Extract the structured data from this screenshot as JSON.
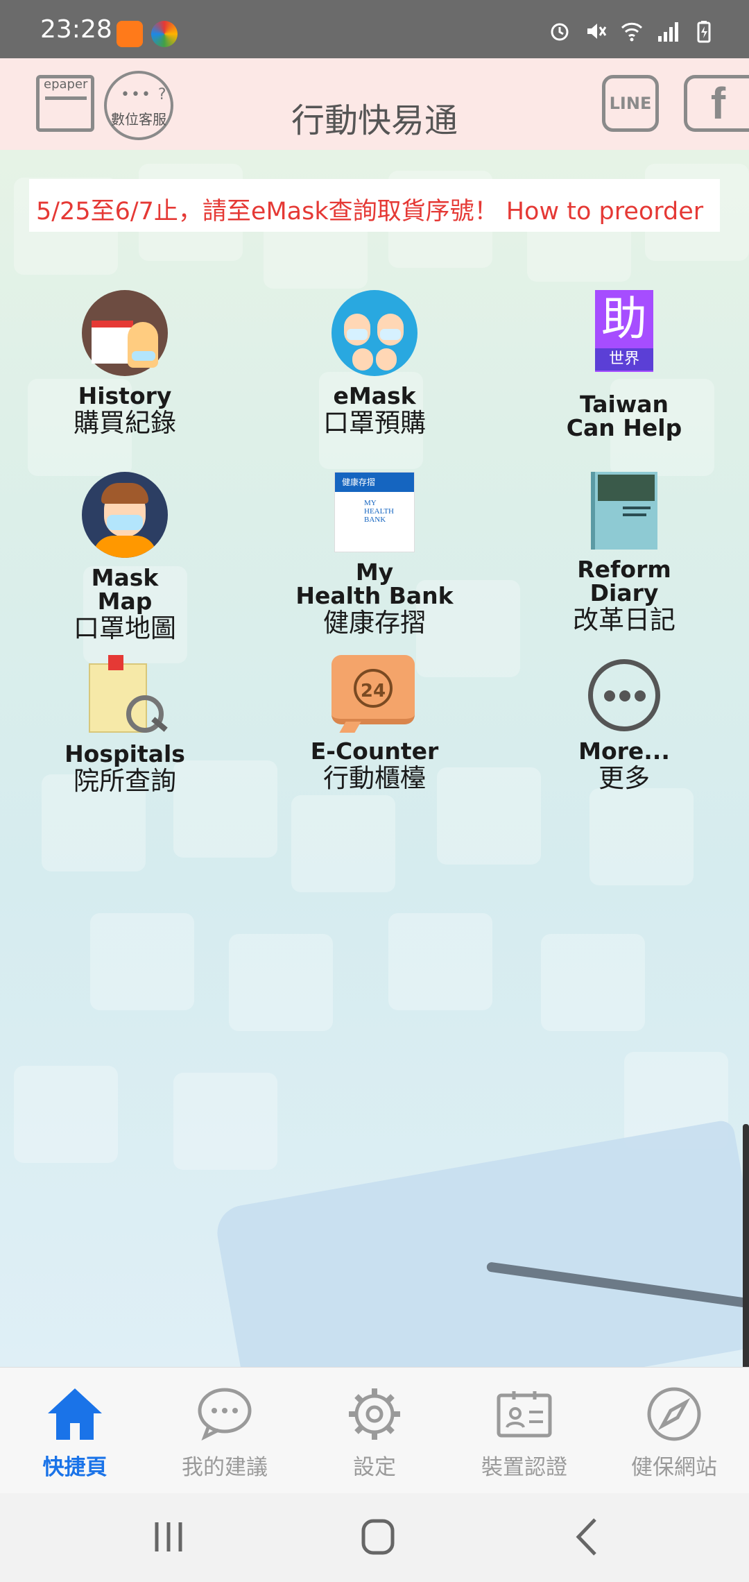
{
  "status_bar": {
    "time": "23:28"
  },
  "header": {
    "title": "行動快易通",
    "epaper_tag": "epaper",
    "service_label": "數位客服",
    "line_label": "LINE",
    "facebook_label": "f"
  },
  "marquee": {
    "text": "5/25至6/7止，請至eMask查詢取貨序號！  How to preorder"
  },
  "grid": [
    {
      "en": "History",
      "zh": "購買紀錄",
      "icon": "calendar-person-icon"
    },
    {
      "en": "eMask",
      "zh": "口罩預購",
      "icon": "mask-family-icon"
    },
    {
      "en": "Taiwan\nCan Help",
      "zh": "",
      "icon": "taiwan-can-help-icon",
      "badge_main": "助",
      "badge_sub": "世界"
    },
    {
      "en": "Mask\nMap",
      "zh": "口罩地圖",
      "icon": "mask-person-icon"
    },
    {
      "en": "My\nHealth Bank",
      "zh": "健康存摺",
      "icon": "health-bank-icon",
      "card_header": "健康存摺",
      "card_text": "MY\nHEALTH\nBANK"
    },
    {
      "en": "Reform\nDiary",
      "zh": "改革日記",
      "icon": "book-icon"
    },
    {
      "en": "Hospitals",
      "zh": "院所查詢",
      "icon": "hospital-search-icon"
    },
    {
      "en": "E-Counter",
      "zh": "行動櫃檯",
      "icon": "24h-counter-icon",
      "counter_text": "24"
    },
    {
      "en": "More...",
      "zh": "更多",
      "icon": "more-icon"
    }
  ],
  "bottom_nav": [
    {
      "label": "快捷頁",
      "icon": "home-icon",
      "active": true
    },
    {
      "label": "我的建議",
      "icon": "chat-icon",
      "active": false
    },
    {
      "label": "設定",
      "icon": "gear-icon",
      "active": false
    },
    {
      "label": "裝置認證",
      "icon": "id-card-icon",
      "active": false
    },
    {
      "label": "健保網站",
      "icon": "compass-icon",
      "active": false
    }
  ],
  "colors": {
    "accent": "#1a73e8",
    "marquee_text": "#e53935",
    "header_bg": "#fce8e6"
  }
}
